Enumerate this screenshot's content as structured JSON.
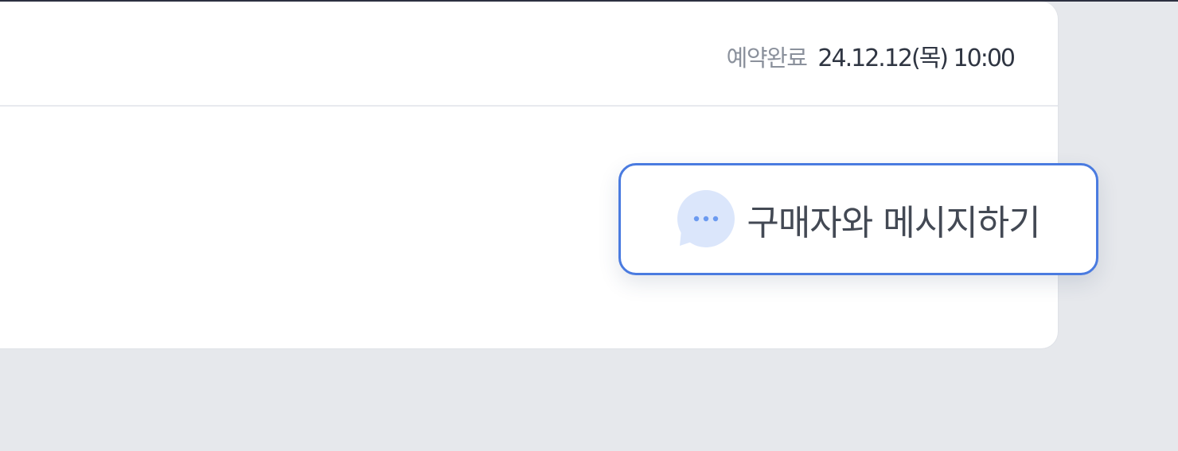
{
  "reservation": {
    "status_label": "예약완료",
    "date_time": "24.12.12(목) 10:00"
  },
  "message_button": {
    "label": "구매자와 메시지하기",
    "icon": "chat-bubble-icon"
  },
  "colors": {
    "background": "#e6e8ec",
    "card": "#ffffff",
    "accent_border": "#4a7be0",
    "icon_fill": "#dbe6fb",
    "icon_dots": "#6b9af0",
    "status_label": "#8b919c",
    "status_date": "#2f3542",
    "button_text": "#434954"
  }
}
